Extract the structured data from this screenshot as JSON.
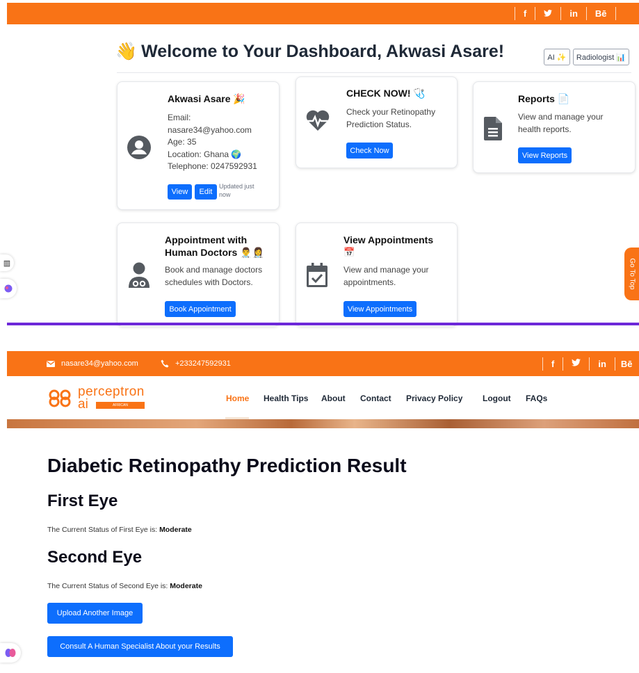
{
  "top_bar": {
    "social": [
      "f",
      "🐦",
      "in",
      "Bē"
    ]
  },
  "dashboard": {
    "welcome": "Welcome to Your Dashboard, Akwasi Asare!",
    "welcome_emoji": "👋",
    "mode_buttons": [
      "AI ✨",
      "Radiologist 📊"
    ],
    "profile": {
      "name": "Akwasi Asare 🎉",
      "lines": [
        "Email:",
        "nasare34@yahoo.com",
        "Age: 35",
        "Location: Ghana 🌍",
        "Telephone: 0247592931"
      ],
      "view_label": "View",
      "edit_label": "Edit",
      "updated": "Updated just now"
    },
    "check": {
      "title": "CHECK NOW! 🩺",
      "body": [
        "Check your Retinopathy",
        "Prediction Status."
      ],
      "button": "Check Now"
    },
    "reports": {
      "title": "Reports 📄",
      "body": [
        "View and manage your",
        "health reports."
      ],
      "button": "View Reports"
    },
    "appointment": {
      "title": [
        "Appointment with",
        "Human Doctors 👨‍⚕️👩‍⚕️"
      ],
      "body": [
        "Book and manage doctors",
        "schedules with Doctors."
      ],
      "button": "Book Appointment"
    },
    "view_appointments": {
      "title": "View Appointments",
      "title_emoji": "📅",
      "body": [
        "View and manage your",
        "appointments."
      ],
      "button": "View Appointments"
    },
    "go_to_top": "Go To Top"
  },
  "site": {
    "email": "nasare34@yahoo.com",
    "phone": "+233247592931",
    "social": [
      "f",
      "🐦",
      "in",
      "Bē"
    ],
    "logo_line1": "perceptron",
    "logo_line2": "ai",
    "logo_tag": "AFRICAN",
    "nav": [
      "Home",
      "Health Tips",
      "About",
      "Contact",
      "Privacy Policy",
      "Logout",
      "FAQs"
    ]
  },
  "result": {
    "title": "Diabetic Retinopathy Prediction Result",
    "first_eye_heading": "First Eye",
    "first_eye_text": "The Current Status of First Eye is: ",
    "first_eye_status": "Moderate",
    "second_eye_heading": "Second Eye",
    "second_eye_text": "The Current Status of Second Eye is: ",
    "second_eye_status": "Moderate",
    "upload_button": "Upload Another Image",
    "consult_button": "Consult A Human Specialist About your Results"
  },
  "colors": {
    "brand_orange": "#f97316",
    "primary_blue": "#0d6efd",
    "purple": "#6d28d9"
  }
}
